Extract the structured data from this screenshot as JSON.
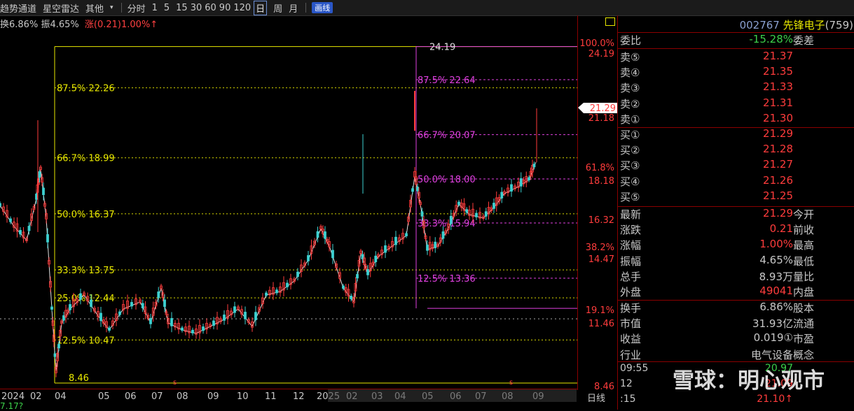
{
  "toolbar": {
    "items": [
      "趋势通道",
      "星空雷达",
      "其他",
      "▾"
    ],
    "periods": [
      "分时",
      "1",
      "5",
      "15",
      "30",
      "60",
      "90",
      "120"
    ],
    "selected": "日",
    "more": [
      "周",
      "月"
    ],
    "draw_button": "画线"
  },
  "info": {
    "turnover": "换6.86%",
    "amplitude": "振4.65%",
    "change": "涨(0.21)1.00%↑"
  },
  "panel": {
    "code": "002767",
    "name": "先锋电子",
    "count": "(759)",
    "commission": {
      "label": "委比",
      "value": "-15.28%",
      "label2": "委差"
    },
    "sells": [
      {
        "label": "卖⑤",
        "price": "21.37"
      },
      {
        "label": "卖④",
        "price": "21.35"
      },
      {
        "label": "卖③",
        "price": "21.33"
      },
      {
        "label": "卖②",
        "price": "21.31"
      },
      {
        "label": "卖①",
        "price": "21.30"
      }
    ],
    "buys": [
      {
        "label": "买①",
        "price": "21.29"
      },
      {
        "label": "买②",
        "price": "21.28"
      },
      {
        "label": "买③",
        "price": "21.27"
      },
      {
        "label": "买④",
        "price": "21.26"
      },
      {
        "label": "买⑤",
        "price": "21.25"
      }
    ],
    "stats": [
      {
        "label": "最新",
        "value": "21.29",
        "label2": "今开",
        "color": "red"
      },
      {
        "label": "涨跌",
        "value": "0.21",
        "label2": "前收",
        "color": "red"
      },
      {
        "label": "涨幅",
        "value": "1.00%",
        "label2": "最高",
        "color": "red"
      },
      {
        "label": "振幅",
        "value": "4.65%",
        "label2": "最低",
        "color": "gray"
      },
      {
        "label": "总手",
        "value": "8.93万",
        "label2": "量比",
        "color": "gray"
      },
      {
        "label": "外盘",
        "value": "49041",
        "label2": "内盘",
        "color": "red"
      }
    ],
    "stats2": [
      {
        "label": "换手",
        "value": "6.86%",
        "label2": "股本",
        "color": "gray"
      },
      {
        "label": "市值",
        "value": "31.93亿",
        "label2": "流通",
        "color": "gray"
      },
      {
        "label": "收益",
        "value": "0.019①",
        "label2": "市盈",
        "color": "gray"
      },
      {
        "label": "行业",
        "value": "电气设备",
        "label2": "概念",
        "color": "gray"
      }
    ],
    "ticks": [
      {
        "time": "09:55",
        "price": "20.97"
      },
      {
        "time": "12",
        "price": "21.09"
      },
      {
        "time": ":15",
        "price": "21.10↑"
      }
    ]
  },
  "watermark": "雪球：明心观市",
  "chart_data": {
    "type": "candlestick",
    "current_price": "21.29",
    "y_ticks": [
      "100.0%",
      "24.19",
      "21.18",
      "61.8%",
      "18.18",
      "16.32",
      "38.2%",
      "14.47",
      "19.1%",
      "11.46",
      "8.46"
    ],
    "x_ticks": [
      "2024",
      "02",
      "04",
      "05",
      "06",
      "07",
      "08",
      "09",
      "10",
      "11",
      "12",
      "2025",
      "02",
      "03",
      "04",
      "05",
      "06",
      "07",
      "08",
      "09"
    ],
    "period_label": "日线",
    "fib_left": {
      "high": "24.19",
      "low": "8.46",
      "levels": [
        {
          "pct": "87.5%",
          "price": "22.26"
        },
        {
          "pct": "66.7%",
          "price": "18.99"
        },
        {
          "pct": "50.0%",
          "price": "16.37"
        },
        {
          "pct": "33.3%",
          "price": "13.75"
        },
        {
          "pct": "25.0%",
          "price": "12.44"
        },
        {
          "pct": "12.5%",
          "price": "10.47"
        }
      ]
    },
    "fib_right": {
      "high": "24.19",
      "levels": [
        {
          "pct": "87.5%",
          "price": "22.64"
        },
        {
          "pct": "66.7%",
          "price": "20.07"
        },
        {
          "pct": "50.0%",
          "price": "18.00"
        },
        {
          "pct": "33.3%",
          "price": "15.94"
        },
        {
          "pct": "12.5%",
          "price": "13.36"
        }
      ]
    },
    "bottom_left": "7.17?"
  },
  "colors": {
    "up": "#ff3c3c",
    "down": "#3cd0d0",
    "fib_left": "#e8e800",
    "fib_right": "#e040e0"
  }
}
